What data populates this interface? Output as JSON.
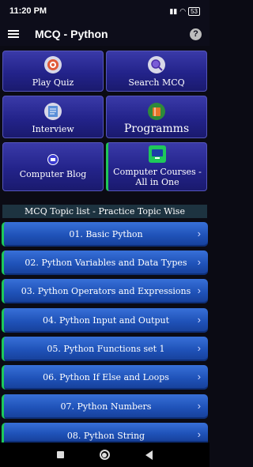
{
  "status": {
    "time": "11:20 PM",
    "battery": "53"
  },
  "appbar": {
    "title": "MCQ - Python"
  },
  "tiles": {
    "play_quiz": "Play Quiz",
    "search_mcq": "Search MCQ",
    "interview": "Interview",
    "programms": "Programms",
    "computer_blog": "Computer Blog",
    "computer_courses": "Computer Courses - All in One"
  },
  "topics": {
    "header": "MCQ Topic list - Practice Topic Wise",
    "items": [
      "01. Basic Python",
      "02. Python Variables and Data Types",
      "03. Python Operators and Expressions",
      "04. Python Input and Output",
      "05. Python Functions set 1",
      "06. Python If Else and Loops",
      "07. Python Numbers",
      "08. Python String"
    ]
  },
  "colors": {
    "accent_green": "#1ec85a",
    "tile_blue": "#23238a",
    "topic_blue": "#1f52b8"
  }
}
